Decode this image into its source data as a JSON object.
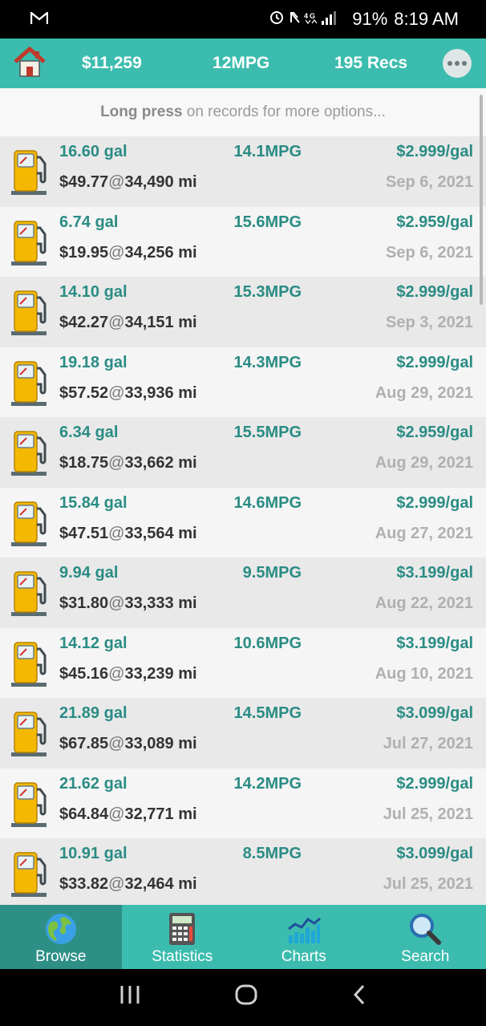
{
  "status_bar": {
    "carrier_icon": "gmail-icon",
    "battery": "91%",
    "time": "8:19 AM"
  },
  "header": {
    "total_cost": "$11,259",
    "avg_mpg": "12MPG",
    "record_count": "195 Recs"
  },
  "hint": {
    "bold": "Long press",
    "rest": " on records for more options..."
  },
  "records": [
    {
      "gal": "16.60 gal",
      "mpg": "14.1MPG",
      "ppg": "$2.999/gal",
      "cost": "$49.77",
      "at": "@",
      "miles": "34,490 mi",
      "date": "Sep 6, 2021"
    },
    {
      "gal": "6.74 gal",
      "mpg": "15.6MPG",
      "ppg": "$2.959/gal",
      "cost": "$19.95",
      "at": "@",
      "miles": "34,256 mi",
      "date": "Sep 6, 2021"
    },
    {
      "gal": "14.10 gal",
      "mpg": "15.3MPG",
      "ppg": "$2.999/gal",
      "cost": "$42.27",
      "at": "@",
      "miles": "34,151 mi",
      "date": "Sep 3, 2021"
    },
    {
      "gal": "19.18 gal",
      "mpg": "14.3MPG",
      "ppg": "$2.999/gal",
      "cost": "$57.52",
      "at": "@",
      "miles": "33,936 mi",
      "date": "Aug 29, 2021"
    },
    {
      "gal": "6.34 gal",
      "mpg": "15.5MPG",
      "ppg": "$2.959/gal",
      "cost": "$18.75",
      "at": "@",
      "miles": "33,662 mi",
      "date": "Aug 29, 2021"
    },
    {
      "gal": "15.84 gal",
      "mpg": "14.6MPG",
      "ppg": "$2.999/gal",
      "cost": "$47.51",
      "at": "@",
      "miles": "33,564 mi",
      "date": "Aug 27, 2021"
    },
    {
      "gal": "9.94 gal",
      "mpg": "9.5MPG",
      "ppg": "$3.199/gal",
      "cost": "$31.80",
      "at": "@",
      "miles": "33,333 mi",
      "date": "Aug 22, 2021"
    },
    {
      "gal": "14.12 gal",
      "mpg": "10.6MPG",
      "ppg": "$3.199/gal",
      "cost": "$45.16",
      "at": "@",
      "miles": "33,239 mi",
      "date": "Aug 10, 2021"
    },
    {
      "gal": "21.89 gal",
      "mpg": "14.5MPG",
      "ppg": "$3.099/gal",
      "cost": "$67.85",
      "at": "@",
      "miles": "33,089 mi",
      "date": "Jul 27, 2021"
    },
    {
      "gal": "21.62 gal",
      "mpg": "14.2MPG",
      "ppg": "$2.999/gal",
      "cost": "$64.84",
      "at": "@",
      "miles": "32,771 mi",
      "date": "Jul 25, 2021"
    },
    {
      "gal": "10.91 gal",
      "mpg": "8.5MPG",
      "ppg": "$3.099/gal",
      "cost": "$33.82",
      "at": "@",
      "miles": "32,464 mi",
      "date": "Jul 25, 2021"
    }
  ],
  "nav": {
    "browse": "Browse",
    "statistics": "Statistics",
    "charts": "Charts",
    "search": "Search"
  },
  "colors": {
    "accent": "#3cbcae",
    "accent_dark": "#2e8f86",
    "value_teal": "#2a8c84"
  }
}
